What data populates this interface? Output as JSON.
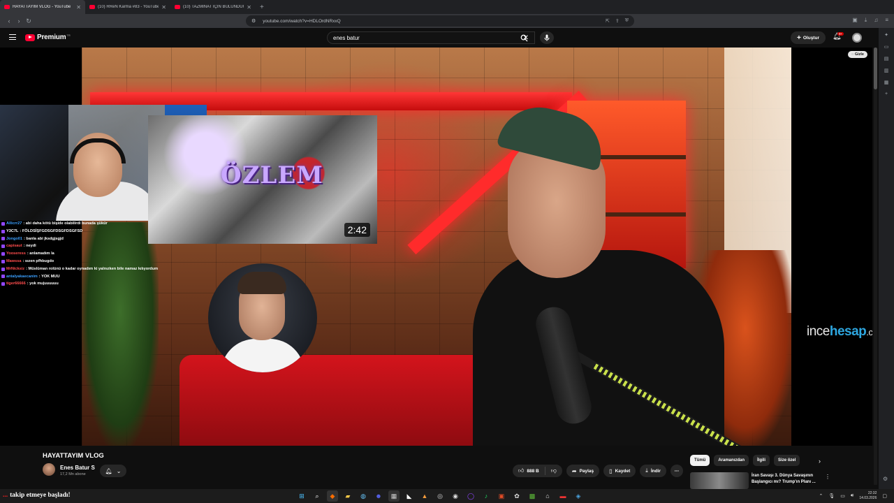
{
  "browser": {
    "tabs": [
      {
        "label": "HAYATTAYIM VLOG - YouTube",
        "active": true
      },
      {
        "label": "(10) RReN Karma #83 - YouTube",
        "active": false
      },
      {
        "label": "(10) TAZMİNAT İÇİN BULUNDUĞU L",
        "active": false
      }
    ],
    "url": "youtube.com/watch?v=HDLOrdNRxxQ"
  },
  "header": {
    "brand": "Premium",
    "brand_suffix": "TR",
    "search_query": "enes batur",
    "create_label": "Oluştur",
    "notification_count": "9+"
  },
  "video": {
    "hide_label": "Gizle",
    "embedded_title": "ÖZLEM",
    "embedded_duration": "2:42",
    "watermark": {
      "part1": "ince",
      "part2": "hesap",
      "part3": ".com"
    },
    "chat": [
      {
        "user": "Allicrr27",
        "user_color": "#3ba0ff",
        "msg": ": abi daha kötü bişide olabilirdi bunada şükür"
      },
      {
        "user": "Y3C7L",
        "user_color": "#ffffff",
        "msg": ": FÖLDSİŞFGDSGFDSGFDSGFSD"
      },
      {
        "user": "Jongo01",
        "user_color": "#3ba0ff",
        "msg": ": banla abi jksdgjsgjd"
      },
      {
        "user": "capisaut",
        "user_color": "#ff4d4d",
        "msg": ": neydi"
      },
      {
        "user": "Yooseress",
        "user_color": "#ff4d4d",
        "msg": ": anlamadım la"
      },
      {
        "user": "Mawssa",
        "user_color": "#ff4d4d",
        "msg": ": sızen pfhbugdo"
      },
      {
        "user": "MrNicksiz",
        "user_color": "#ff4d4d",
        "msg": ": Müslüman rolünü o kadar oynadım ki yalnızken bile namaz kılıyordum"
      },
      {
        "user": "antalyakaecanim",
        "user_color": "#3ba0ff",
        "msg": ": YOK MUU"
      },
      {
        "user": "tiger66666",
        "user_color": "#ff4d4d",
        "msg": ": yok mujuuuuuu"
      }
    ]
  },
  "details": {
    "title": "HAYATTAYIM VLOG",
    "channel": "Enes Batur S",
    "subscribers": "17,2 Mn abone",
    "like_count": "888 B",
    "share_label": "Paylaş",
    "save_label": "Kaydet",
    "download_label": "İndir"
  },
  "chips": [
    "Tümü",
    "Aramanızdan",
    "İlgili",
    "Size özel"
  ],
  "recommendation": {
    "title": "İran Savaşı 3. Dünya Savaşının Başlangıcı mı? Trump'ın Planı ..."
  },
  "taskbar": {
    "notification_name": "...",
    "notification_text": "takip etmeye başladı!",
    "time": "22:32",
    "date": "14.03.2026"
  }
}
